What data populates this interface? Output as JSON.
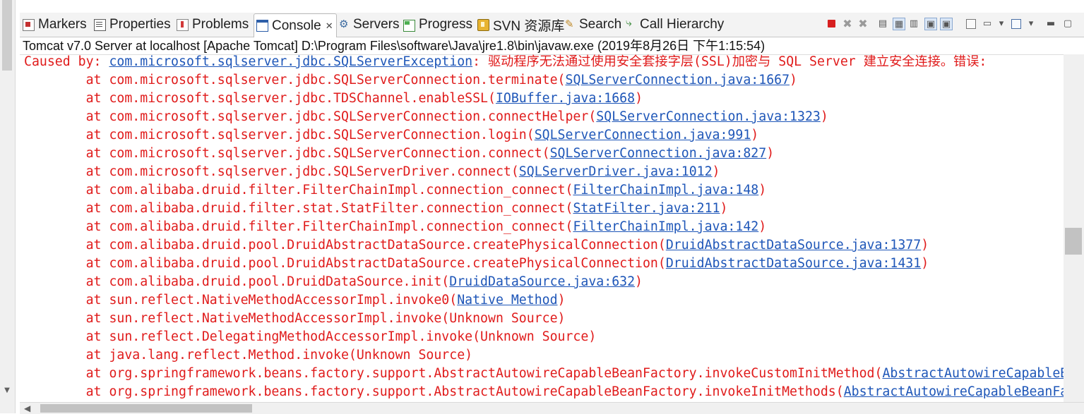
{
  "tabs": [
    {
      "label": "Markers",
      "icon": "markers-icon"
    },
    {
      "label": "Properties",
      "icon": "properties-icon"
    },
    {
      "label": "Problems",
      "icon": "problems-icon"
    },
    {
      "label": "Console",
      "icon": "console-icon",
      "active": true,
      "close": "✕"
    },
    {
      "label": "Servers",
      "icon": "servers-icon"
    },
    {
      "label": "Progress",
      "icon": "progress-icon"
    },
    {
      "label": "SVN 资源库",
      "icon": "svn-repository-icon"
    },
    {
      "label": "Search",
      "icon": "search-icon"
    },
    {
      "label": "Call Hierarchy",
      "icon": "call-hierarchy-icon"
    }
  ],
  "console": {
    "header": "Tomcat v7.0 Server at localhost [Apache Tomcat] D:\\Program Files\\software\\Java\\jre1.8\\bin\\javaw.exe (2019年8月26日 下午1:15:54)",
    "lines": [
      {
        "pre": "Caused by: ",
        "link": "com.microsoft.sqlserver.jdbc.SQLServerException",
        "post": ": 驱动程序无法通过使用安全套接字层(SSL)加密与 SQL Server 建立安全连接。错误: "
      },
      {
        "pre": "        at com.microsoft.sqlserver.jdbc.SQLServerConnection.terminate(",
        "link": "SQLServerConnection.java:1667",
        "post": ")"
      },
      {
        "pre": "        at com.microsoft.sqlserver.jdbc.TDSChannel.enableSSL(",
        "link": "IOBuffer.java:1668",
        "post": ")"
      },
      {
        "pre": "        at com.microsoft.sqlserver.jdbc.SQLServerConnection.connectHelper(",
        "link": "SQLServerConnection.java:1323",
        "post": ")"
      },
      {
        "pre": "        at com.microsoft.sqlserver.jdbc.SQLServerConnection.login(",
        "link": "SQLServerConnection.java:991",
        "post": ")"
      },
      {
        "pre": "        at com.microsoft.sqlserver.jdbc.SQLServerConnection.connect(",
        "link": "SQLServerConnection.java:827",
        "post": ")"
      },
      {
        "pre": "        at com.microsoft.sqlserver.jdbc.SQLServerDriver.connect(",
        "link": "SQLServerDriver.java:1012",
        "post": ")"
      },
      {
        "pre": "        at com.alibaba.druid.filter.FilterChainImpl.connection_connect(",
        "link": "FilterChainImpl.java:148",
        "post": ")"
      },
      {
        "pre": "        at com.alibaba.druid.filter.stat.StatFilter.connection_connect(",
        "link": "StatFilter.java:211",
        "post": ")"
      },
      {
        "pre": "        at com.alibaba.druid.filter.FilterChainImpl.connection_connect(",
        "link": "FilterChainImpl.java:142",
        "post": ")"
      },
      {
        "pre": "        at com.alibaba.druid.pool.DruidAbstractDataSource.createPhysicalConnection(",
        "link": "DruidAbstractDataSource.java:1377",
        "post": ")"
      },
      {
        "pre": "        at com.alibaba.druid.pool.DruidAbstractDataSource.createPhysicalConnection(",
        "link": "DruidAbstractDataSource.java:1431",
        "post": ")"
      },
      {
        "pre": "        at com.alibaba.druid.pool.DruidDataSource.init(",
        "link": "DruidDataSource.java:632",
        "post": ")"
      },
      {
        "pre": "        at sun.reflect.NativeMethodAccessorImpl.invoke0(",
        "link": "Native Method",
        "post": ")"
      },
      {
        "pre": "        at sun.reflect.NativeMethodAccessorImpl.invoke(Unknown Source)",
        "link": "",
        "post": ""
      },
      {
        "pre": "        at sun.reflect.DelegatingMethodAccessorImpl.invoke(Unknown Source)",
        "link": "",
        "post": ""
      },
      {
        "pre": "        at java.lang.reflect.Method.invoke(Unknown Source)",
        "link": "",
        "post": ""
      },
      {
        "pre": "        at org.springframework.beans.factory.support.AbstractAutowireCapableBeanFactory.invokeCustomInitMethod(",
        "link": "AbstractAutowireCapableBeanFactory.java",
        "post": ""
      },
      {
        "pre": "        at org.springframework.beans.factory.support.AbstractAutowireCapableBeanFactory.invokeInitMethods(",
        "link": "AbstractAutowireCapableBeanFactory.java",
        "post": ""
      }
    ]
  },
  "colors": {
    "error_text": "#e01b1b",
    "link": "#1e56b8",
    "stop_button": "#d71f1f"
  },
  "toolbar_icons": [
    "terminate-icon",
    "remove-launch-icon",
    "remove-all-terminated-icon",
    "clear-console-icon",
    "scroll-lock-icon",
    "word-wrap-icon",
    "show-on-stdout-icon",
    "show-on-stderr-icon",
    "pin-console-icon",
    "display-selected-console-icon",
    "open-console-icon",
    "view-menu-icon",
    "minimize-icon",
    "maximize-icon"
  ],
  "scroll": {
    "vertical_fraction": 0.5,
    "horizontal_fraction": 0.0
  }
}
